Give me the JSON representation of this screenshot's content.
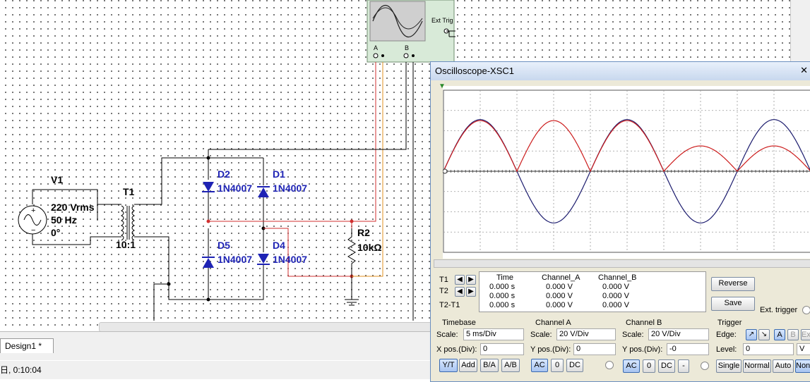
{
  "circuit": {
    "source": {
      "name": "V1",
      "voltage": "220 Vrms",
      "freq": "50 Hz",
      "phase": "0°"
    },
    "transformer": {
      "name": "T1",
      "ratio": "10:1"
    },
    "diodes": [
      {
        "name": "D2",
        "model": "1N4007"
      },
      {
        "name": "D1",
        "model": "1N4007"
      },
      {
        "name": "D5",
        "model": "1N4007"
      },
      {
        "name": "D4",
        "model": "1N4007"
      }
    ],
    "resistor": {
      "name": "R2",
      "value": "10kΩ"
    },
    "scope_ext_trig": "Ext Trig",
    "scope_pin_a": "A",
    "scope_pin_b": "B"
  },
  "tab": {
    "label": "Design1 *"
  },
  "status": {
    "text": "日, 0:10:04"
  },
  "oscilloscope": {
    "title": "Oscilloscope-XSC1",
    "cursors": {
      "t1": "T1",
      "t2": "T2",
      "t2t1": "T2-T1"
    },
    "readout": {
      "headers": [
        "Time",
        "Channel_A",
        "Channel_B"
      ],
      "rows": [
        [
          "0.000 s",
          "0.000 V",
          "0.000 V"
        ],
        [
          "0.000 s",
          "0.000 V",
          "0.000 V"
        ],
        [
          "0.000 s",
          "0.000 V",
          "0.000 V"
        ]
      ]
    },
    "buttons": {
      "reverse": "Reverse",
      "save": "Save",
      "ext_trigger": "Ext. trigger"
    },
    "timebase": {
      "title": "Timebase",
      "scale_label": "Scale:",
      "scale": "5 ms/Div",
      "xpos_label": "X pos.(Div):",
      "xpos": "0",
      "modes": [
        "Y/T",
        "Add",
        "B/A",
        "A/B"
      ],
      "selected": "Y/T"
    },
    "channel_a": {
      "title": "Channel A",
      "scale_label": "Scale:",
      "scale": "20  V/Div",
      "ypos_label": "Y pos.(Div):",
      "ypos": "0",
      "coupling": [
        "AC",
        "0",
        "DC"
      ],
      "selected": "AC"
    },
    "channel_b": {
      "title": "Channel B",
      "scale_label": "Scale:",
      "scale": "20  V/Div",
      "ypos_label": "Y pos.(Div):",
      "ypos": "-0",
      "coupling": [
        "AC",
        "0",
        "DC",
        "-"
      ],
      "selected": "AC"
    },
    "trigger": {
      "title": "Trigger",
      "edge_label": "Edge:",
      "level_label": "Level:",
      "level": "0",
      "level_unit": "V",
      "sources": [
        "A",
        "B",
        "Ext"
      ],
      "selected_source": "A",
      "modes": [
        "Single",
        "Normal",
        "Auto",
        "None"
      ],
      "selected_mode": "None"
    },
    "trace_colors": {
      "channel_a": "#cc1c1c",
      "channel_b": "#1c1c6e"
    }
  },
  "chart_data": {
    "type": "line",
    "x_unit": "ms",
    "xlim": [
      0,
      50
    ],
    "ylim": [
      -80,
      80
    ],
    "series": [
      {
        "name": "Channel_A",
        "color": "#cc1c1c",
        "x": [
          0,
          2.5,
          5,
          7.5,
          10,
          12.5,
          15,
          17.5,
          20,
          22.5,
          25,
          27.5,
          29.9,
          30,
          32.5,
          35,
          37.5,
          40,
          42.5,
          45,
          47.5,
          50
        ],
        "y": [
          0,
          36,
          50,
          36,
          0,
          36,
          50,
          36,
          0,
          36,
          50,
          36,
          12,
          25,
          18,
          0,
          18,
          25,
          18,
          0,
          18,
          25
        ]
      },
      {
        "name": "Channel_B",
        "color": "#1c1c6e",
        "x": [
          0,
          2.5,
          5,
          7.5,
          10,
          12.5,
          15,
          17.5,
          20,
          22.5,
          25,
          27.5,
          30,
          32.5,
          35,
          37.5,
          40,
          42.5,
          45,
          47.5,
          50
        ],
        "y": [
          0,
          36,
          51,
          36,
          0,
          -36,
          -51,
          -36,
          0,
          36,
          51,
          36,
          0,
          -36,
          -51,
          -36,
          0,
          36,
          51,
          36,
          0
        ]
      }
    ]
  }
}
